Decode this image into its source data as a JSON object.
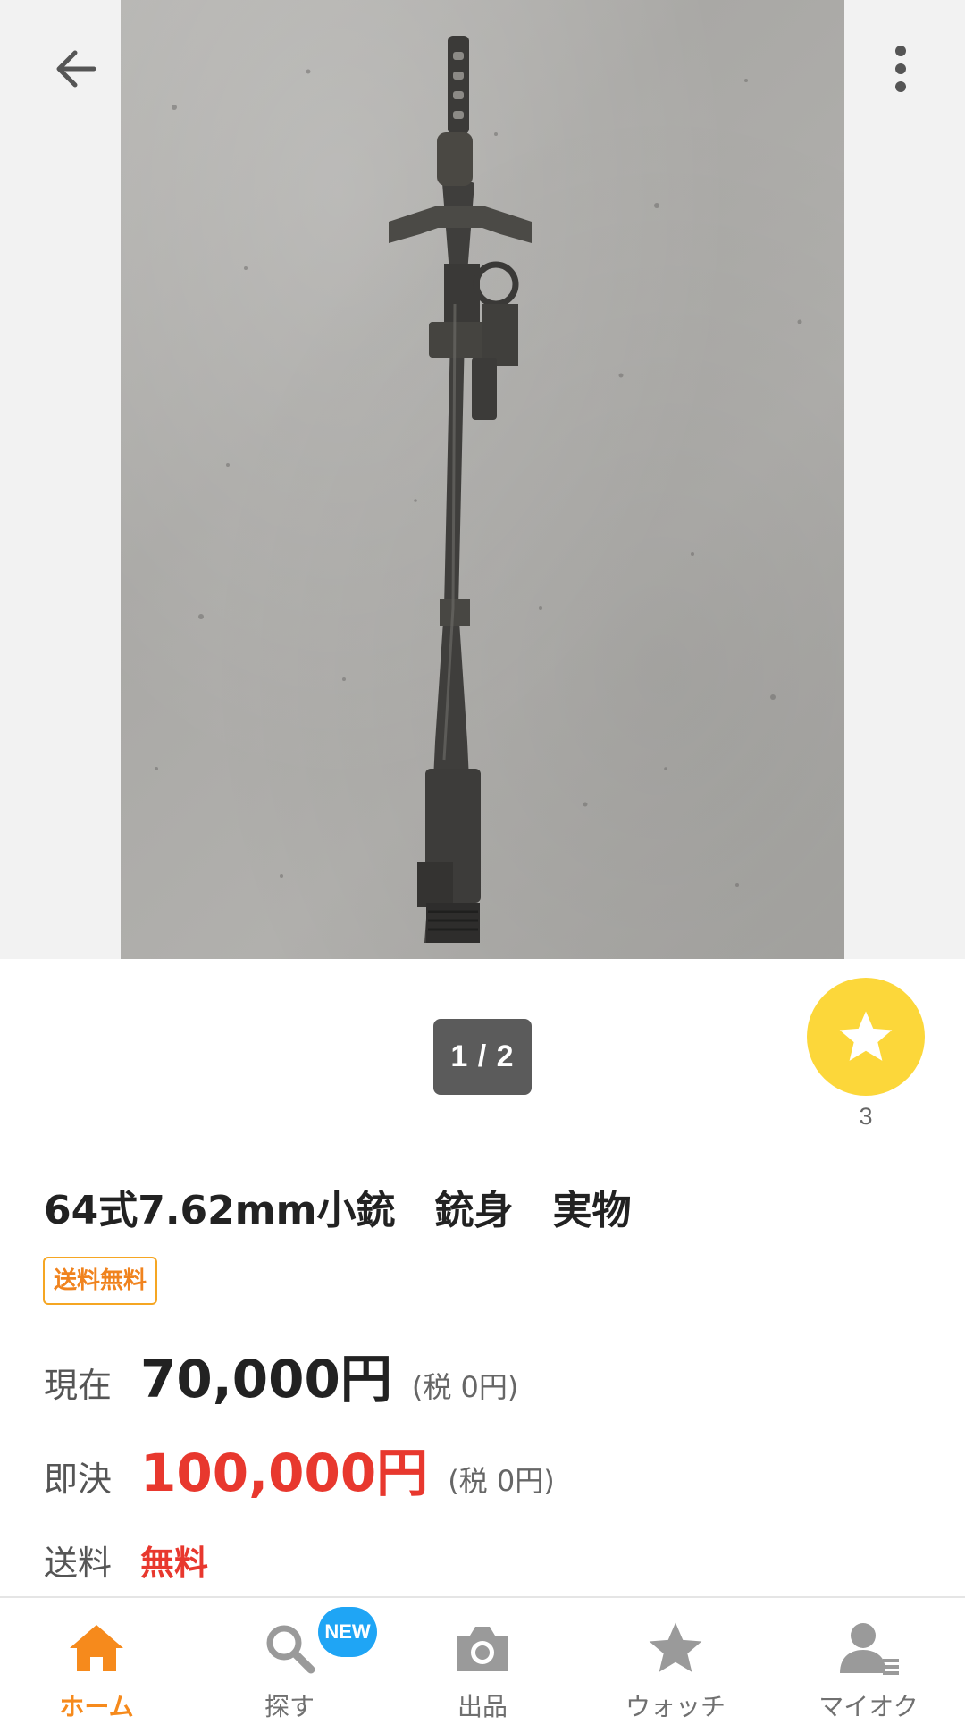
{
  "gallery": {
    "page_current": "1",
    "page_total": "2",
    "page_indicator": "1 / 2",
    "photo_subject": "rifle barrel on concrete"
  },
  "icons": {
    "back": "arrow-left-icon",
    "more": "more-vertical-icon",
    "watch": "star-icon"
  },
  "watch": {
    "count": "3"
  },
  "item": {
    "title": "64式7.62mm小銃　銃身　実物",
    "shipping_badge": "送料無料",
    "current_label": "現在",
    "current_price": "70,000円",
    "current_tax": "(税 0円)",
    "buynow_label": "即決",
    "buynow_price": "100,000円",
    "buynow_tax": "(税 0円)",
    "shipping_label": "送料",
    "shipping_value": "無料"
  },
  "tabbar": {
    "tabs": [
      {
        "label": "ホーム",
        "icon": "home-icon",
        "active": true
      },
      {
        "label": "探す",
        "icon": "search-icon",
        "badge": "NEW"
      },
      {
        "label": "出品",
        "icon": "camera-icon"
      },
      {
        "label": "ウォッチ",
        "icon": "star-icon"
      },
      {
        "label": "マイオク",
        "icon": "user-icon"
      }
    ]
  },
  "colors": {
    "accent_orange": "#f68a1c",
    "price_red": "#e8382e",
    "watch_yellow": "#fcd73a",
    "new_badge_blue": "#1fa5f5"
  }
}
